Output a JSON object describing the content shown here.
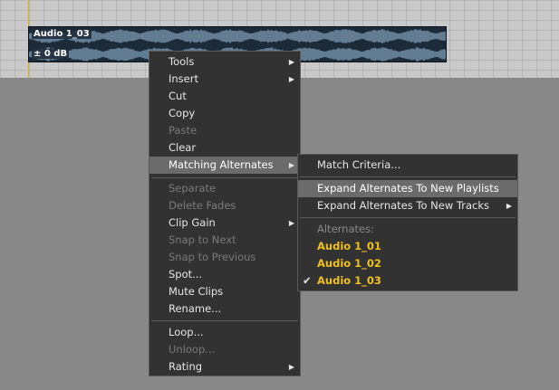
{
  "clip": {
    "name": "Audio 1_03",
    "gain": "± 0 dB"
  },
  "colors": {
    "track_bg": "#c9c9c9",
    "clip_bg": "#1d2a38",
    "waveform": "#8fb3cf",
    "menu_bg": "#323232",
    "highlight": "#6b6b6b",
    "alternate_text": "#f0c020"
  },
  "main_menu": {
    "items": [
      {
        "label": "Tools",
        "has_submenu": true,
        "enabled": true
      },
      {
        "label": "Insert",
        "has_submenu": true,
        "enabled": true
      },
      {
        "label": "Cut",
        "enabled": true
      },
      {
        "label": "Copy",
        "enabled": true
      },
      {
        "label": "Paste",
        "enabled": false
      },
      {
        "label": "Clear",
        "enabled": true
      },
      {
        "label": "Matching Alternates",
        "has_submenu": true,
        "enabled": true,
        "highlighted": true
      },
      {
        "label": "Separate",
        "enabled": false
      },
      {
        "label": "Delete Fades",
        "enabled": false
      },
      {
        "label": "Clip Gain",
        "has_submenu": true,
        "enabled": true
      },
      {
        "label": "Snap to Next",
        "enabled": false
      },
      {
        "label": "Snap to Previous",
        "enabled": false
      },
      {
        "label": "Spot...",
        "enabled": true
      },
      {
        "label": "Mute Clips",
        "enabled": true
      },
      {
        "label": "Rename...",
        "enabled": true
      },
      {
        "label": "Loop...",
        "enabled": true
      },
      {
        "label": "Unloop...",
        "enabled": false
      },
      {
        "label": "Rating",
        "has_submenu": true,
        "enabled": true
      }
    ]
  },
  "submenu": {
    "items": [
      {
        "label": "Match Criteria...",
        "enabled": true
      },
      {
        "label": "Expand Alternates To New Playlists",
        "enabled": true,
        "highlighted": true
      },
      {
        "label": "Expand Alternates To New Tracks",
        "has_submenu": true,
        "enabled": true
      },
      {
        "label": "Alternates:",
        "header": true
      },
      {
        "label": "Audio 1_01",
        "alternate": true
      },
      {
        "label": "Audio 1_02",
        "alternate": true
      },
      {
        "label": "Audio 1_03",
        "alternate": true,
        "checked": true
      }
    ],
    "check_glyph": "✔",
    "arrow_glyph": "▶"
  }
}
